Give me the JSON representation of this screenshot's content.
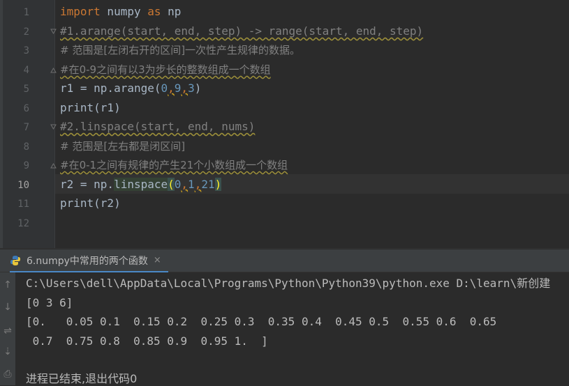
{
  "editor": {
    "lines": [
      {
        "num": "1"
      },
      {
        "num": "2"
      },
      {
        "num": "3"
      },
      {
        "num": "4"
      },
      {
        "num": "5"
      },
      {
        "num": "6"
      },
      {
        "num": "7"
      },
      {
        "num": "8"
      },
      {
        "num": "9"
      },
      {
        "num": "10"
      },
      {
        "num": "11"
      },
      {
        "num": "12"
      }
    ],
    "code": {
      "l1_kw1": "import",
      "l1_mid": " numpy ",
      "l1_kw2": "as",
      "l1_end": " np",
      "l2": "#1.arange(start, end, step) -> range(start, end, step)",
      "l3": "# 范围是[左闭右开的区间]一次性产生规律的数据。",
      "l4": "#在0-9之间有以3为步长的整数组成一个数组",
      "l5_a": "r1 = np.arange(",
      "l5_n1": "0",
      "l5_c1": ",",
      "l5_n2": "9",
      "l5_c2": ",",
      "l5_n3": "3",
      "l5_b": ")",
      "l6": "print(r1)",
      "l7": "#2.linspace(start, end, nums)",
      "l8": "# 范围是[左右都是闭区间]",
      "l9": "#在0-1之间有规律的产生21个小数组成一个数组",
      "l10_a": "r2 = np.",
      "l10_fn": "linspace",
      "l10_p1": "(",
      "l10_n1": "0",
      "l10_c1": ",",
      "l10_n2": "1",
      "l10_c2": ",",
      "l10_n3": "21",
      "l10_p2": ")",
      "l11": "print(r2)"
    }
  },
  "run_panel": {
    "tab_label": "6.numpy中常用的两个函数",
    "close_glyph": "×"
  },
  "console": {
    "lines": [
      "C:\\Users\\dell\\AppData\\Local\\Programs\\Python\\Python39\\python.exe D:\\learn\\新创建",
      "[0 3 6]",
      "[0.   0.05 0.1  0.15 0.2  0.25 0.3  0.35 0.4  0.45 0.5  0.55 0.6  0.65",
      " 0.7  0.75 0.8  0.85 0.9  0.95 1.  ]",
      "",
      "进程已结束,退出代码0"
    ]
  },
  "icons": {
    "up": "↑",
    "down": "↓",
    "wrap": "⇌",
    "scroll": "⇣",
    "print": "⎙"
  },
  "colors": {
    "background": "#2b2b2b",
    "keyword": "#cc7832",
    "comment": "#808080",
    "number": "#6897bb",
    "accent": "#4a88c7"
  }
}
